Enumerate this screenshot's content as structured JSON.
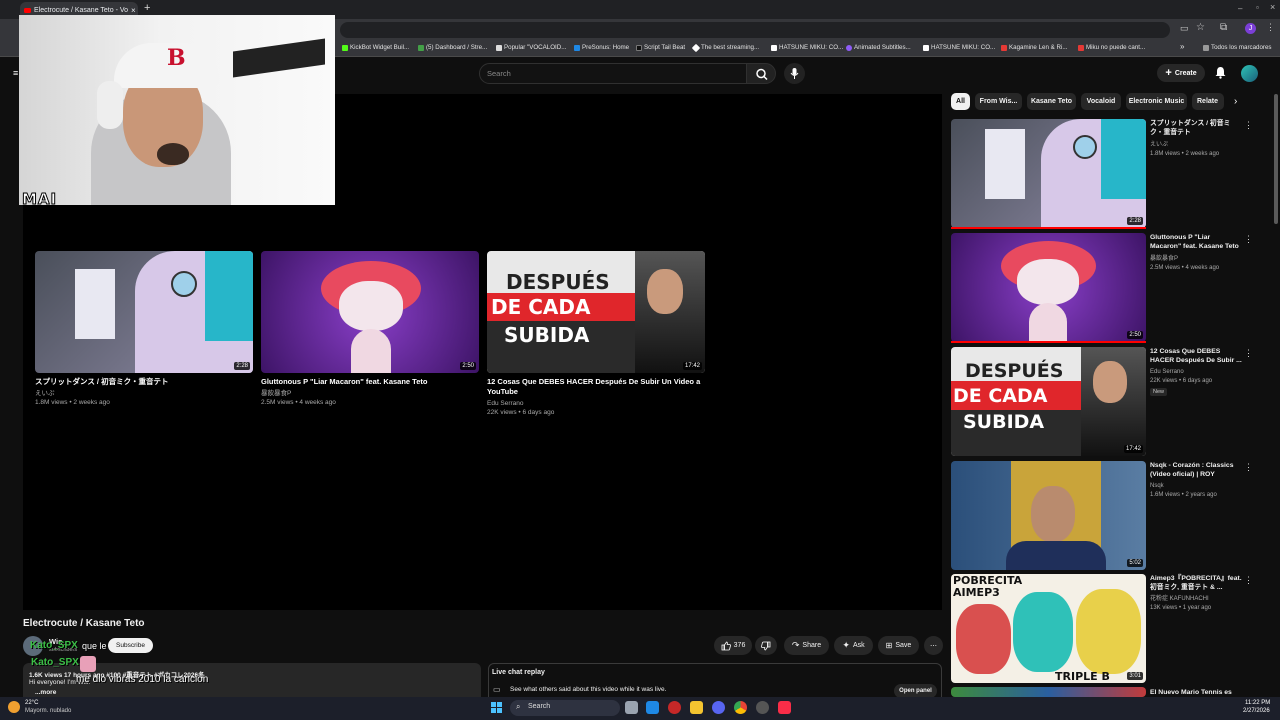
{
  "browser": {
    "tab_title": "Electrocute / Kasane Teto - Vo",
    "bookmarks": [
      "KickBot Widget Buil...",
      "(5) Dashboard / Stre...",
      "Popular \"VOCALOID...",
      "PreSonus: Home",
      "Script Tail Beat",
      "The best streaming...",
      "HATSUNE MIKU: CO...",
      "Animated Subtitles...",
      "HATSUNE MIKU: CO...",
      "Kagamine Len & Ri...",
      "Miku no puede cant..."
    ],
    "all_bookmarks": "Todos los marcadores"
  },
  "header": {
    "search_placeholder": "Search",
    "create_label": "Create"
  },
  "player": {
    "end_cards": [
      {
        "title": "スプリットダンス / 初音ミク・重音テト",
        "channel": "えいぷ",
        "stats": "1.8M views • 2 weeks ago",
        "duration": "2:28"
      },
      {
        "title": "Gluttonous P \"Liar Macaron\" feat. Kasane Teto",
        "channel": "暴飲暴食P",
        "stats": "2.5M views • 4 weeks ago",
        "duration": "2:50"
      },
      {
        "title": "12 Cosas Que DEBES HACER Después De Subir Un Video a YouTube",
        "channel": "Edu Serrano",
        "stats": "22K views • 6 days ago",
        "duration": "17:42"
      }
    ],
    "thumb_text": {
      "line1": "DESPUÉS",
      "line2": "DE CADA",
      "line3": "SUBIDA"
    }
  },
  "video": {
    "title": "Electrocute / Kasane Teto",
    "channel": "Wis_",
    "subs": "subscribers",
    "subscribe": "Subscribe",
    "likes": "376",
    "share": "Share",
    "ask": "Ask",
    "save": "Save",
    "desc_stats": "1.6K views  17 hours ago  #100 #重音テト #ボカコレ2026冬",
    "desc_line": "Hi everyone! I'm Wis.",
    "more": "...more"
  },
  "live_chat": {
    "title": "Live chat replay",
    "desc": "See what others said about this video while it was live.",
    "open": "Open panel"
  },
  "chips": [
    "All",
    "From Wis...",
    "Kasane Teto",
    "Vocaloid",
    "Electronic Music",
    "Relate"
  ],
  "sidebar": [
    {
      "title": "スプリットダンス / 初音ミク・重音テト",
      "channel": "えいぷ",
      "stats": "1.8M views • 2 weeks ago",
      "duration": "2:28"
    },
    {
      "title": "Gluttonous P \"Liar Macaron\" feat. Kasane Teto",
      "channel": "暴飲暴食P",
      "stats": "2.5M views • 4 weeks ago",
      "duration": "2:50"
    },
    {
      "title": "12 Cosas Que DEBES HACER Después De Subir ...",
      "channel": "Edu Serrano",
      "stats": "22K views • 6 days ago",
      "badge": "New",
      "duration": "17:42"
    },
    {
      "title": "Nsqk - Corazón : Classics (Video oficial) | ROY",
      "channel": "Nsqk",
      "stats": "1.6M views • 2 years ago",
      "duration": "5:02"
    },
    {
      "title": "Aimep3『POBRECITA』feat. 初音ミク, 重音テト & ...",
      "channel": "花粉症 KAFUNHACHI",
      "stats": "13K views • 1 year ago",
      "duration": "3:01"
    },
    {
      "title": "El Nuevo Mario Tennis es",
      "channel": "",
      "stats": "",
      "duration": ""
    }
  ],
  "sidebar_thumb_text": {
    "pobrecita": "POBRECITA",
    "aimep3": "AIMEP3",
    "triple": "TRIPLE B"
  },
  "webcam": {
    "label": "MAI"
  },
  "stream_chat": {
    "name": "Kato_SPX",
    "name_overlap": "Kato_SPX",
    "msg1": "que le",
    "msg2": "me dio vibras 2010 la cancion"
  },
  "taskbar": {
    "temp": "22°C",
    "weather": "Mayorm. nublado",
    "search": "Search",
    "time": "11:22 PM",
    "date": "2/27/2026"
  }
}
